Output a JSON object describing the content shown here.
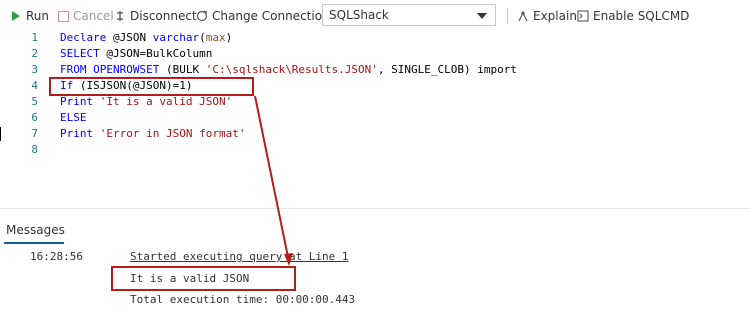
{
  "toolbar": {
    "run": "Run",
    "cancel": "Cancel",
    "disconnect": "Disconnect",
    "change_connection": "Change Connection",
    "database": "SQLShack",
    "explain": "Explain",
    "enable_sqlcmd": "Enable SQLCMD"
  },
  "editor": {
    "line_numbers": [
      "1",
      "2",
      "3",
      "4",
      "5",
      "6",
      "7",
      "8"
    ],
    "lines": [
      [
        {
          "t": "kw",
          "v": "Declare"
        },
        {
          "t": "plain",
          "v": " @JSON "
        },
        {
          "t": "kw",
          "v": "varchar"
        },
        {
          "t": "plain",
          "v": "("
        },
        {
          "t": "fn",
          "v": "max"
        },
        {
          "t": "plain",
          "v": ")"
        }
      ],
      [
        {
          "t": "kw",
          "v": "SELECT"
        },
        {
          "t": "plain",
          "v": " @JSON=BulkColumn"
        }
      ],
      [
        {
          "t": "kw",
          "v": "FROM"
        },
        {
          "t": "plain",
          "v": " "
        },
        {
          "t": "kw",
          "v": "OPENROWSET"
        },
        {
          "t": "plain",
          "v": " (BULK "
        },
        {
          "t": "str",
          "v": "'C:\\sqlshack\\Results.JSON'"
        },
        {
          "t": "plain",
          "v": ", SINGLE_CLOB) import"
        }
      ],
      [
        {
          "t": "kw",
          "v": "If"
        },
        {
          "t": "plain",
          "v": " (ISJSON(@JSON)=1)"
        }
      ],
      [
        {
          "t": "kw",
          "v": "Print"
        },
        {
          "t": "plain",
          "v": " "
        },
        {
          "t": "str",
          "v": "'It is a valid JSON'"
        }
      ],
      [
        {
          "t": "kw",
          "v": "ELSE"
        }
      ],
      [
        {
          "t": "kw",
          "v": "Print"
        },
        {
          "t": "plain",
          "v": " "
        },
        {
          "t": "str",
          "v": "'Error in JSON format'"
        }
      ],
      []
    ]
  },
  "messages": {
    "tab_label": "Messages",
    "rows": [
      {
        "time": "16:28:56",
        "text": "Started executing query at Line 1"
      },
      {
        "time": "",
        "text": "It is a valid JSON"
      },
      {
        "time": "",
        "text": "Total execution time: 00:00:00.443"
      }
    ]
  },
  "colors": {
    "annotation": "#b71c1c",
    "run_green": "#2e9e44",
    "keyword": "#0000ff",
    "string": "#a31515",
    "line_number": "#237893"
  },
  "icons": [
    "play-icon",
    "stop-icon",
    "disconnect-icon",
    "change-connection-icon",
    "chevron-down-icon",
    "explain-icon",
    "sqlcmd-icon"
  ]
}
